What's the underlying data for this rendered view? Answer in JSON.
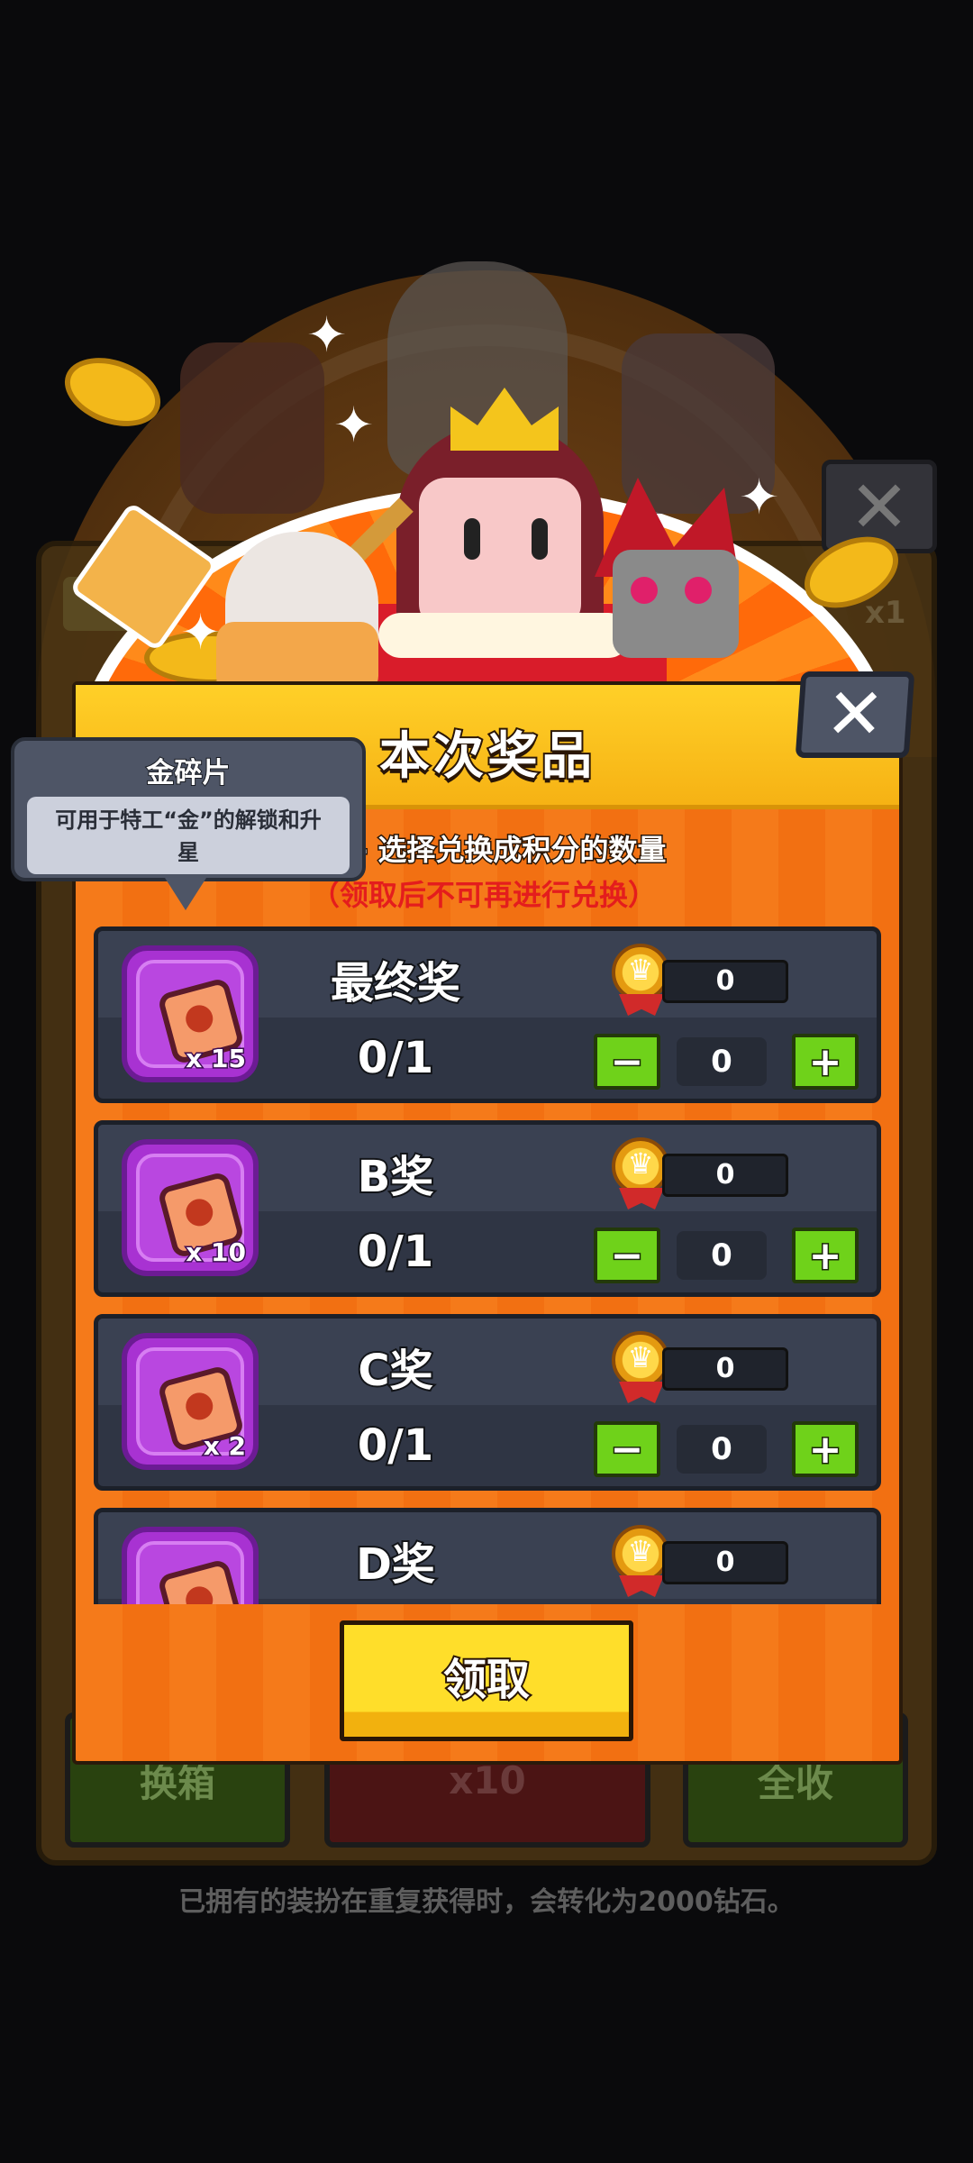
{
  "background": {
    "bottom_buttons": [
      "换箱",
      "x10",
      "全收"
    ],
    "note": "已拥有的装扮在重复获得时，会转化为2000钻石。",
    "multiplier": "x1"
  },
  "modal": {
    "title": "本次奖品",
    "instruction": "- 选择兑换成积分的数量",
    "warning": "（领取后不可再进行兑换）",
    "close_symbol": "✕",
    "claim_label": "领取"
  },
  "tooltip": {
    "title": "金碎片",
    "body": "可用于特工“金”的解锁和升星"
  },
  "prizes": [
    {
      "name": "最终奖",
      "quantity": "x 15",
      "progress": "0/1",
      "points": "0",
      "count": "0"
    },
    {
      "name": "B奖",
      "quantity": "x 10",
      "progress": "0/1",
      "points": "0",
      "count": "0"
    },
    {
      "name": "C奖",
      "quantity": "x 2",
      "progress": "0/1",
      "points": "0",
      "count": "0"
    },
    {
      "name": "D奖",
      "quantity": "",
      "progress": "",
      "points": "0",
      "count": ""
    }
  ],
  "stepper": {
    "minus": "−",
    "plus": "+"
  },
  "colors": {
    "modal_orange": "#f57a1a",
    "header_yellow": "#ffd028",
    "row_dark": "#2f3544",
    "prize_icon_purple": "#a832d2",
    "stepper_green": "#6fd21a",
    "warning_red": "#e41d1d"
  },
  "icons": [
    "close-icon",
    "gold-medal-icon",
    "puzzle-shard-icon"
  ]
}
